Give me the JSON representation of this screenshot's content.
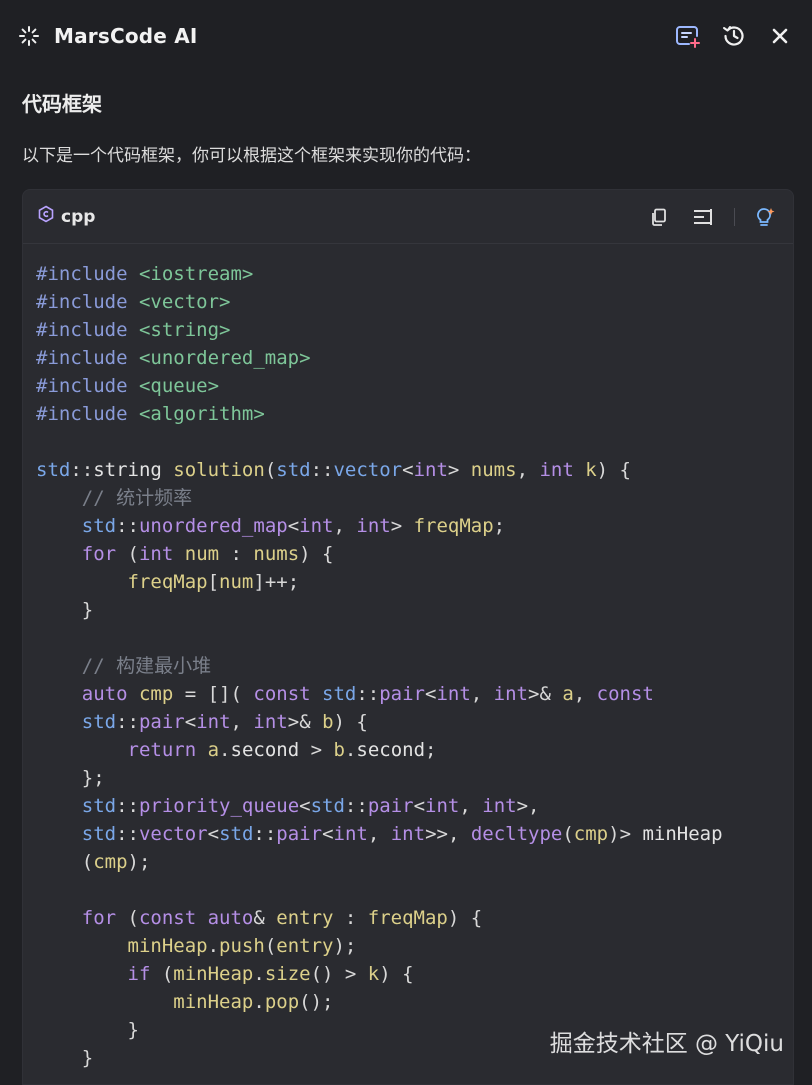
{
  "header": {
    "title": "MarsCode AI",
    "icons": [
      "sparkle-logo-icon",
      "new-chat-icon",
      "history-icon",
      "close-icon"
    ]
  },
  "section_title": "代码框架",
  "intro_text": "以下是一个代码框架，你可以根据这个框架来实现你的代码：",
  "code_block": {
    "language": "cpp",
    "tools": [
      "copy-icon",
      "insert-icon",
      "ai-suggest-icon"
    ],
    "lines": [
      "#include <iostream>",
      "#include <vector>",
      "#include <string>",
      "#include <unordered_map>",
      "#include <queue>",
      "#include <algorithm>",
      "",
      "std::string solution(std::vector<int> nums, int k) {",
      "    // 统计频率",
      "    std::unordered_map<int, int> freqMap;",
      "    for (int num : nums) {",
      "        freqMap[num]++;",
      "    }",
      "",
      "    // 构建最小堆",
      "    auto cmp = [](const std::pair<int, int>& a, const",
      "    std::pair<int, int>& b) {",
      "        return a.second > b.second;",
      "    };",
      "    std::priority_queue<std::pair<int, int>,",
      "    std::vector<std::pair<int, int>>, decltype(cmp)> minHeap",
      "    (cmp);",
      "",
      "    for (const auto& entry : freqMap) {",
      "        minHeap.push(entry);",
      "        if (minHeap.size() > k) {",
      "            minHeap.pop();",
      "        }",
      "    }"
    ]
  },
  "watermark": "掘金技术社区 @ YiQiu",
  "colors": {
    "background": "#1f2024",
    "code_bg": "#2a2b30",
    "preprocessor": "#8a9bd9",
    "string": "#7ec699",
    "type": "#7aa7e8",
    "keyword": "#b58fe6",
    "identifier": "#dcd08a",
    "comment": "#7a7f8a"
  }
}
